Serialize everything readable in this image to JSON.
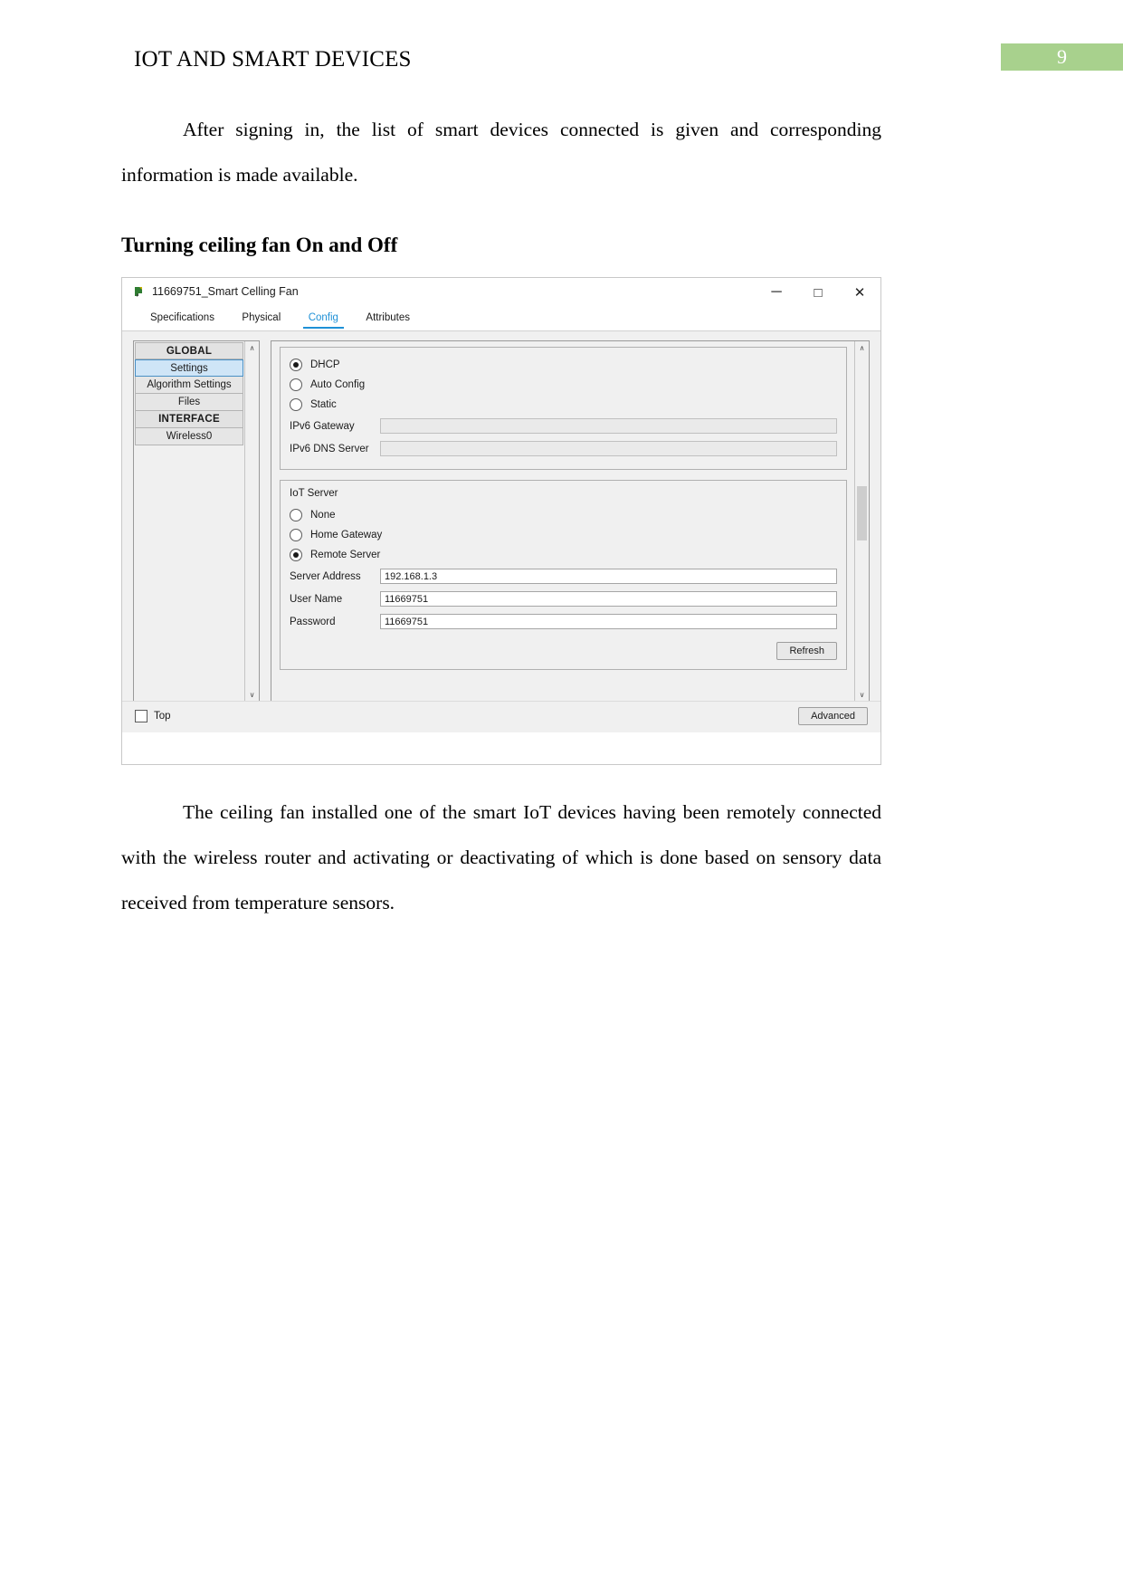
{
  "header": {
    "document_title": "IOT AND SMART DEVICES",
    "page_number": "9",
    "badge_color": "#a8d18d"
  },
  "content": {
    "paragraph_1": "After signing in, the list of smart devices connected is given and corresponding information is made available.",
    "heading": "Turning ceiling fan On and Off",
    "paragraph_2": "The ceiling fan installed one of the smart IoT devices having been remotely connected with the wireless router and activating or deactivating of which is done based on sensory data received from temperature sensors."
  },
  "screenshot": {
    "window": {
      "title": "11669751_Smart Celling Fan",
      "minimize_label": "─",
      "maximize_label": "□",
      "close_label": "✕"
    },
    "tabs": [
      {
        "label": "Specifications",
        "active": false
      },
      {
        "label": "Physical",
        "active": false
      },
      {
        "label": "Config",
        "active": true
      },
      {
        "label": "Attributes",
        "active": false
      }
    ],
    "accent_color": "#1e90d6",
    "nav": {
      "items": [
        {
          "label": "GLOBAL",
          "type": "group",
          "selected": false
        },
        {
          "label": "Settings",
          "type": "item",
          "selected": true
        },
        {
          "label": "Algorithm Settings",
          "type": "item",
          "selected": false
        },
        {
          "label": "Files",
          "type": "item",
          "selected": false
        },
        {
          "label": "INTERFACE",
          "type": "group",
          "selected": false
        },
        {
          "label": "Wireless0",
          "type": "item",
          "selected": false
        }
      ],
      "scroll_up": "∧",
      "scroll_down": "∨"
    },
    "ipv6_section": {
      "options": [
        {
          "label": "DHCP",
          "checked": true
        },
        {
          "label": "Auto Config",
          "checked": false
        },
        {
          "label": "Static",
          "checked": false
        }
      ],
      "fields": [
        {
          "label": "IPv6 Gateway",
          "value": "",
          "disabled": true
        },
        {
          "label": "IPv6 DNS Server",
          "value": "",
          "disabled": true
        }
      ]
    },
    "iot_server_section": {
      "legend": "IoT Server",
      "options": [
        {
          "label": "None",
          "checked": false
        },
        {
          "label": "Home Gateway",
          "checked": false
        },
        {
          "label": "Remote Server",
          "checked": true
        }
      ],
      "fields": [
        {
          "label": "Server Address",
          "value": "192.168.1.3",
          "disabled": false
        },
        {
          "label": "User Name",
          "value": "11669751",
          "disabled": false
        },
        {
          "label": "Password",
          "value": "11669751",
          "disabled": false
        }
      ],
      "refresh_label": "Refresh"
    },
    "footer": {
      "top_checkbox_label": "Top",
      "advanced_label": "Advanced"
    },
    "scrollbar": {
      "up_arrow": "∧",
      "down_arrow": "∨"
    }
  }
}
